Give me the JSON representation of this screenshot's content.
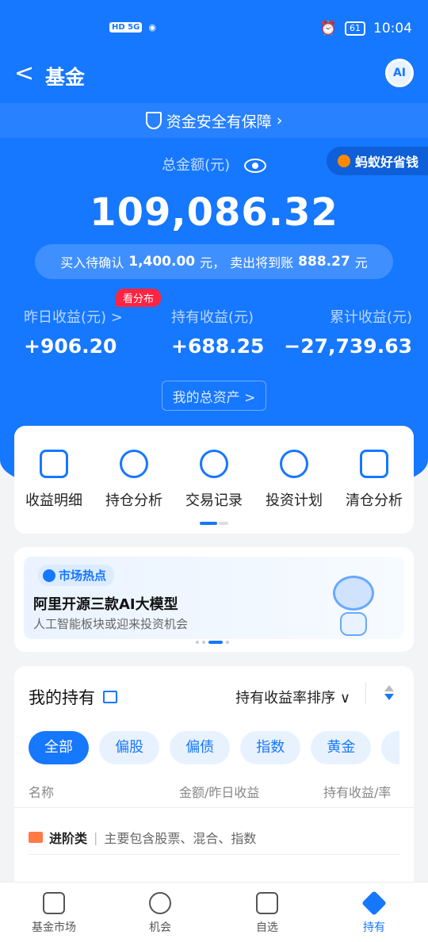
{
  "status_bar": {
    "signal_left": "HD 5G",
    "battery": "61",
    "time": "10:04"
  },
  "nav": {
    "back": "<",
    "title": "基金",
    "ai_label": "AI"
  },
  "safety_banner": "资金安全有保障",
  "total": {
    "label": "总金额(元)",
    "amount": "109,086.32",
    "ant_promo": "蚂蚁好省钱"
  },
  "pending": {
    "buy_label": "买入待确认",
    "buy_amount": "1,400.00",
    "buy_unit": "元，",
    "sell_label": "卖出将到账",
    "sell_amount": "888.27",
    "sell_unit": "元"
  },
  "stats": {
    "yesterday_label": "昨日收益(元) >",
    "yesterday_value": "+906.20",
    "holding_label": "持有收益(元)",
    "holding_value": "+688.25",
    "cumulative_label": "累计收益(元)",
    "cumulative_value": "−27,739.63",
    "badge": "看分布"
  },
  "total_assets_button": "我的总资产 >",
  "quick_actions": [
    {
      "label": "收益明细",
      "icon": "document-icon"
    },
    {
      "label": "持仓分析",
      "icon": "pie-chart-icon"
    },
    {
      "label": "交易记录",
      "icon": "exchange-icon"
    },
    {
      "label": "投资计划",
      "icon": "trend-icon"
    },
    {
      "label": "清仓分析",
      "icon": "chart-board-icon"
    }
  ],
  "banner": {
    "tag": "市场热点",
    "title": "阿里开源三款AI大模型",
    "subtitle": "人工智能板块或迎来投资机会"
  },
  "holdings": {
    "title": "我的持有",
    "sort_label": "持有收益率排序 ∨",
    "filters": [
      "全部",
      "偏股",
      "偏债",
      "指数",
      "黄金"
    ],
    "columns": {
      "name": "名称",
      "amount": "金额/昨日收益",
      "return": "持有收益/率"
    },
    "category": {
      "name": "进阶类",
      "sep": "|",
      "desc": "主要包含股票、混合、指数"
    }
  },
  "tabbar": [
    {
      "label": "基金市场",
      "icon": "market-icon"
    },
    {
      "label": "机会",
      "icon": "binoculars-icon"
    },
    {
      "label": "自选",
      "icon": "add-watchlist-icon"
    },
    {
      "label": "持有",
      "icon": "layers-icon",
      "active": true
    }
  ],
  "colors": {
    "brand_blue": "#1677ff",
    "badge_red": "#ff2442",
    "category_orange": "#ff7a45"
  }
}
